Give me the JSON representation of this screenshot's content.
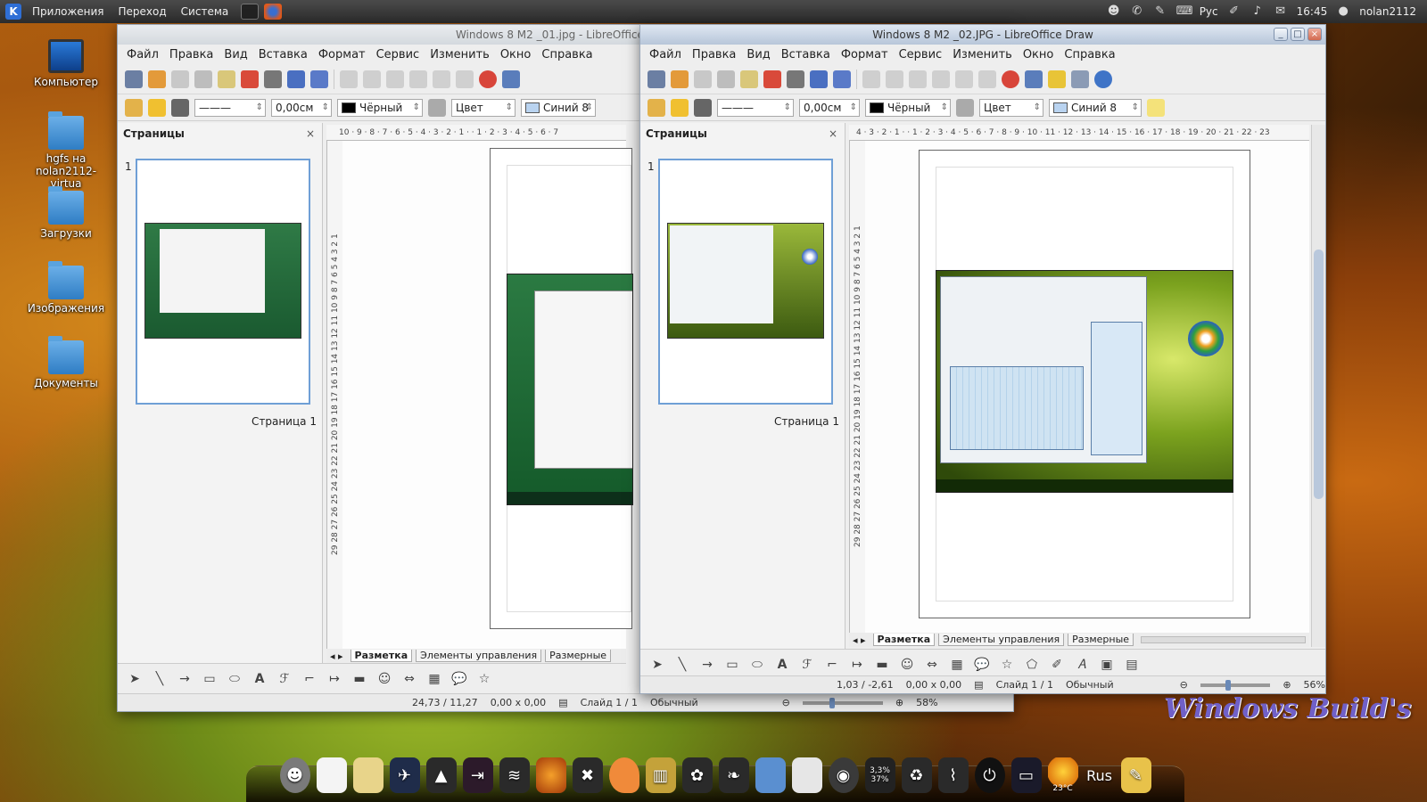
{
  "top_panel": {
    "menu": [
      "Приложения",
      "Переход",
      "Система"
    ],
    "layout": "Рус",
    "time": "16:45",
    "user": "nolan2112"
  },
  "desktop": {
    "icons": [
      "Компьютер",
      "hgfs на nolan2112-virtua",
      "Загрузки",
      "Изображения",
      "Документы"
    ]
  },
  "window1": {
    "title": "Windows 8 M2 _01.jpg - LibreOffice Draw",
    "menu": [
      "Файл",
      "Правка",
      "Вид",
      "Вставка",
      "Формат",
      "Сервис",
      "Изменить",
      "Окно",
      "Справка"
    ],
    "fmt": {
      "line_width": "0,00см",
      "color_name": "Чёрный",
      "area": "Цвет",
      "fill": "Синий 8"
    },
    "pages_panel": {
      "title": "Страницы",
      "close": "×",
      "page_num": "1",
      "page_label": "Страница 1"
    },
    "hruler": "10 · 9 · 8 · 7 · 6 · 5 · 4 · 3 · 2 · 1 · · 1 · 2 · 3 · 4 · 5 · 6 · 7",
    "vruler": "29 28 27 26 25 24 23 22 21 20 19 18 17 16 15 14 13 12 11 10 9 8 7 6 5 4 3 2 1",
    "tabs": [
      "Разметка",
      "Элементы управления",
      "Размерные"
    ],
    "status": {
      "position": "24,73 / 11,27",
      "size": "0,00 x 0,00",
      "slide": "Слайд 1 / 1",
      "layout": "Обычный",
      "zoom": "58%"
    }
  },
  "window2": {
    "title": "Windows 8 M2 _02.JPG - LibreOffice Draw",
    "menu": [
      "Файл",
      "Правка",
      "Вид",
      "Вставка",
      "Формат",
      "Сервис",
      "Изменить",
      "Окно",
      "Справка"
    ],
    "fmt": {
      "line_width": "0,00см",
      "color_name": "Чёрный",
      "area": "Цвет",
      "fill": "Синий 8"
    },
    "pages_panel": {
      "title": "Страницы",
      "close": "×",
      "page_num": "1",
      "page_label": "Страница 1"
    },
    "hruler": "4 · 3 · 2 · 1 · · 1 · 2 · 3 · 4 · 5 · 6 · 7 · 8 · 9 · 10 · 11 · 12 · 13 · 14 · 15 · 16 · 17 · 18 · 19 · 20 · 21 · 22 · 23",
    "vruler": "29 28 27 26 25 24 23 22 21 20 19 18 17 16 15 14 13 12 11 10 9 8 7 6 5 4 3 2 1",
    "tabs": [
      "Разметка",
      "Элементы управления",
      "Размерные"
    ],
    "status": {
      "position": "1,03 / -2,61",
      "size": "0,00 x 0,00",
      "slide": "Слайд 1 / 1",
      "layout": "Обычный",
      "zoom": "56%"
    }
  },
  "dock": {
    "cpu_top": "3,3%",
    "cpu_bottom": "37%",
    "weather": "23°C",
    "lang": "Rus"
  },
  "watermark": "Windows Build's"
}
